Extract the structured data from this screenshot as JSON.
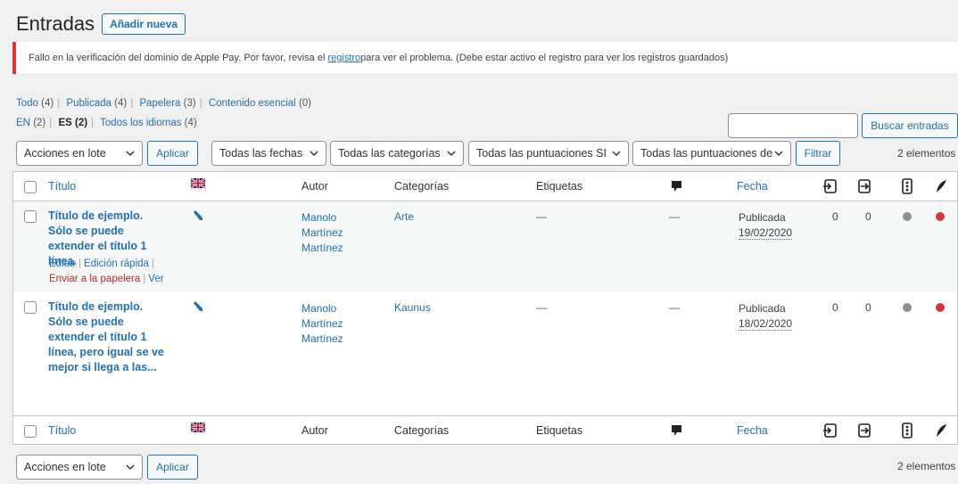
{
  "header": {
    "title": "Entradas",
    "add_new": "Añadir nueva"
  },
  "notice": {
    "text_before": "Fallo en la verificación del dominio de Apple Pay. Por favor, revisa el ",
    "link": "registro",
    "text_after": " para ver el problema. (Debe estar activo el registro para ver los registros guardados)",
    "border_color": "#d63638"
  },
  "views": [
    {
      "label": "Todo",
      "count": "(4)"
    },
    {
      "label": "Publicada",
      "count": "(4)"
    },
    {
      "label": "Papelera",
      "count": "(3)"
    },
    {
      "label": "Contenido esencial",
      "count": "(0)"
    }
  ],
  "languages": [
    {
      "label": "EN",
      "count": "(2)"
    },
    {
      "label": "ES",
      "count": "(2)"
    },
    {
      "label": "Todos los idiomas",
      "count": "(4)"
    }
  ],
  "search": {
    "button": "Buscar entradas",
    "value": ""
  },
  "toolbar": {
    "bulk_actions": "Acciones en lote",
    "apply": "Aplicar",
    "dates": "Todas las fechas",
    "categories": "Todas las categorías",
    "scores_seo": "Todas las puntuaciones SI",
    "scores_read": "Todas las puntuaciones de",
    "filter": "Filtrar",
    "count": "2 elementos"
  },
  "columns": {
    "title": "Título",
    "author": "Autor",
    "categories": "Categorías",
    "tags": "Etiquetas",
    "date": "Fecha"
  },
  "rows": [
    {
      "title": "Título de ejemplo. Sólo se puede extender el título 1 línea.",
      "author": [
        "Manolo",
        "Martínez",
        "Martínez"
      ],
      "category": "Arte",
      "tags": "—",
      "comments": "—",
      "status": "Publicada",
      "date": "19/02/2020",
      "links_out": "0",
      "links_in": "0",
      "actions": {
        "edit": "Editar",
        "quick_edit": "Edición rápida",
        "trash": "Enviar a la papelera",
        "view": "Ver"
      }
    },
    {
      "title": "Título de ejemplo. Sólo se puede extender el título 1 línea, pero igual se ve mejor si llega a las...",
      "author": [
        "Manolo",
        "Martínez",
        "Martínez"
      ],
      "category": "Kaunus",
      "tags": "—",
      "comments": "—",
      "status": "Publicada",
      "date": "18/02/2020",
      "links_out": "0",
      "links_in": "0"
    }
  ],
  "bottom_toolbar": {
    "bulk_actions": "Acciones en lote",
    "apply": "Aplicar",
    "count": "2 elementos"
  },
  "colors": {
    "link": "#2271b1",
    "seo_dot": "#8c8f94",
    "readability_dot": "#d63638"
  }
}
